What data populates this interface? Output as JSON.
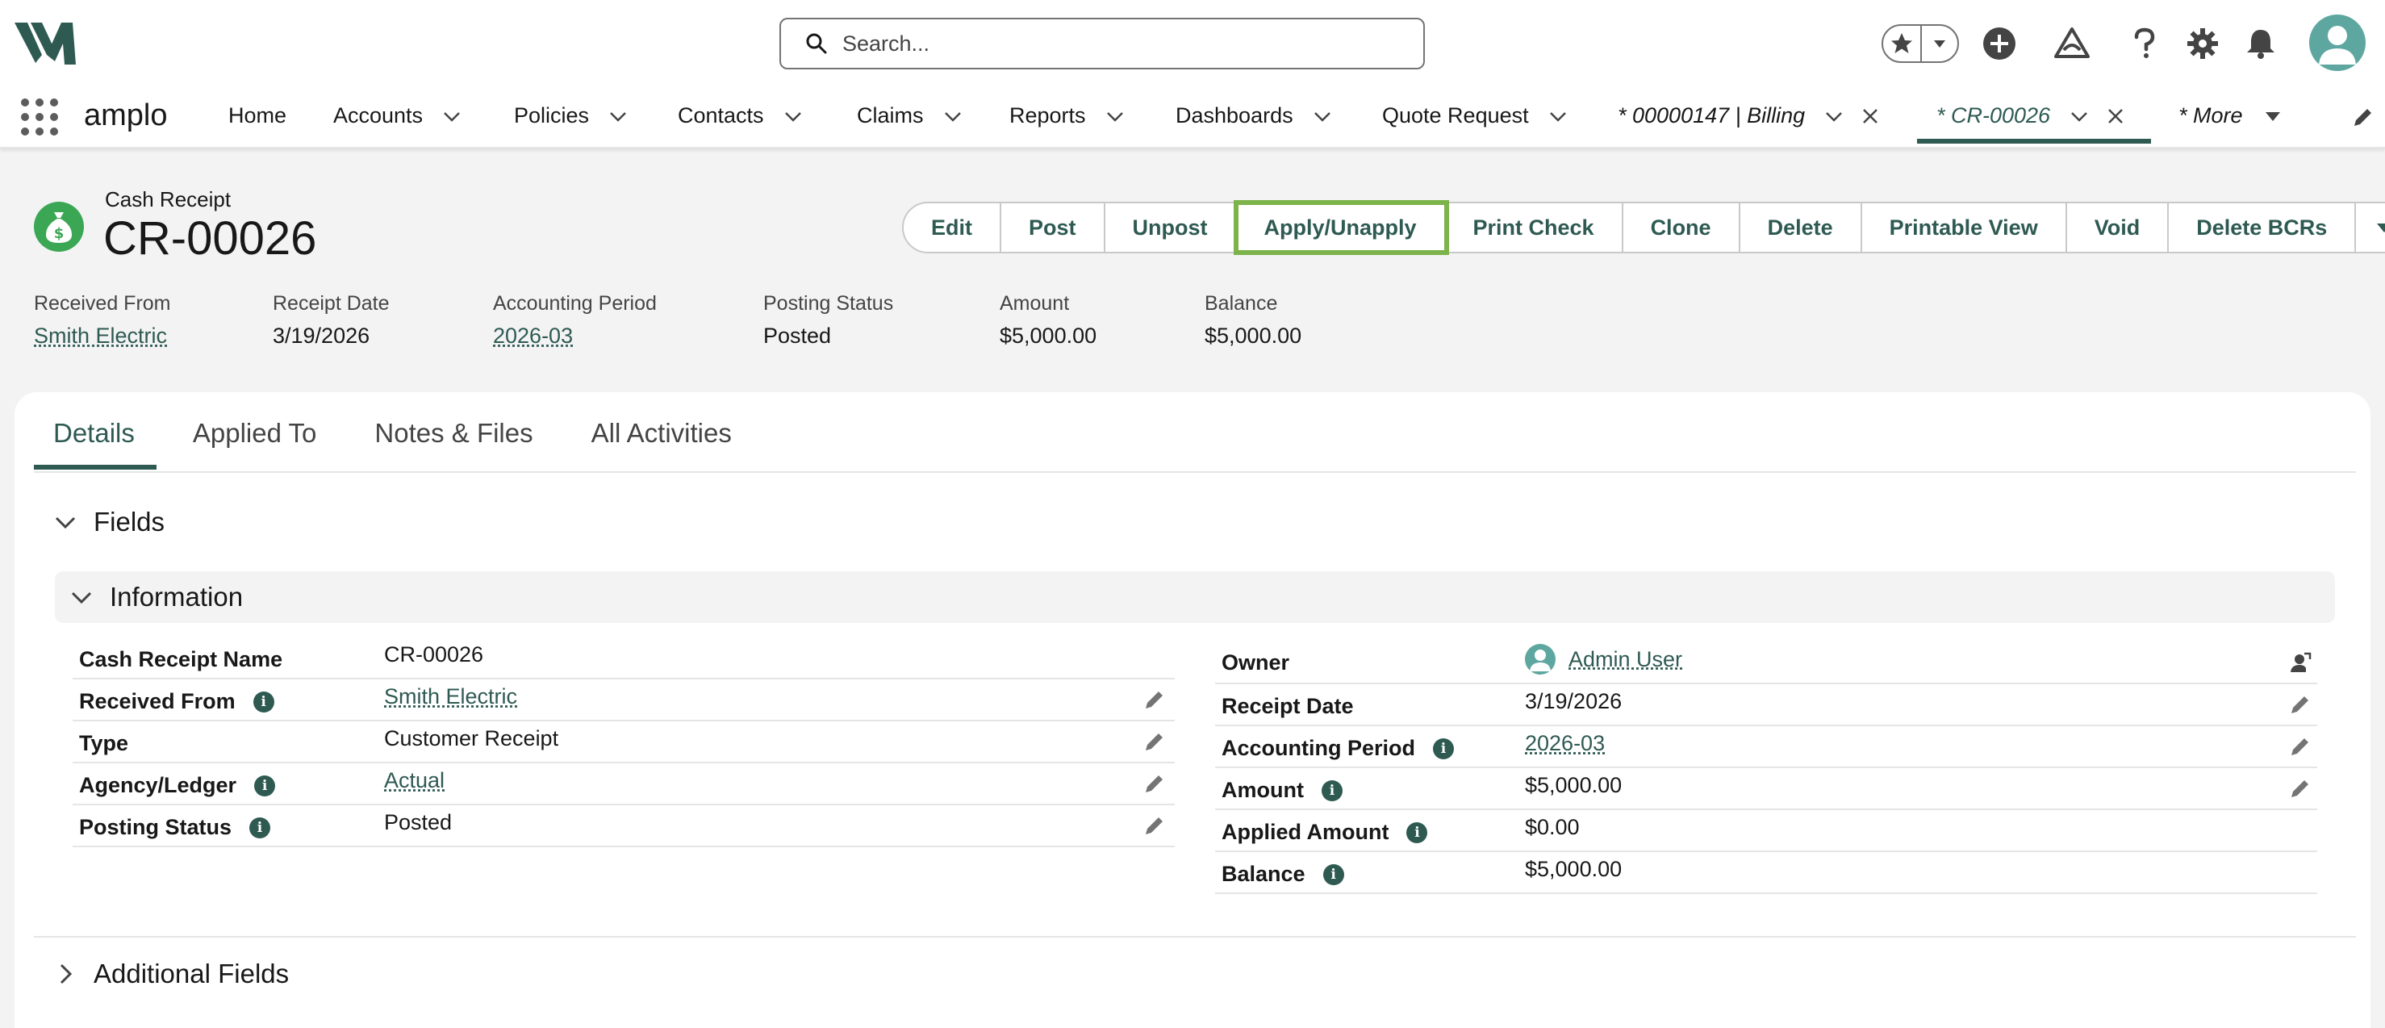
{
  "search": {
    "placeholder": "Search..."
  },
  "app": {
    "name": "amplo"
  },
  "nav": {
    "items": [
      {
        "label": "Home"
      },
      {
        "label": "Accounts"
      },
      {
        "label": "Policies"
      },
      {
        "label": "Contacts"
      },
      {
        "label": "Claims"
      },
      {
        "label": "Reports"
      },
      {
        "label": "Dashboards"
      },
      {
        "label": "Quote Request"
      }
    ],
    "tabs": [
      {
        "label": "* 00000147 | Billing"
      },
      {
        "label": "* CR-00026",
        "active": true
      }
    ],
    "more_label": "* More"
  },
  "record": {
    "type_label": "Cash Receipt",
    "name": "CR-00026",
    "icon": "money-bag-icon",
    "icon_color": "#3ba755"
  },
  "actions": [
    {
      "label": "Edit"
    },
    {
      "label": "Post"
    },
    {
      "label": "Unpost"
    },
    {
      "label": "Apply/Unapply",
      "highlighted": true
    },
    {
      "label": "Print Check"
    },
    {
      "label": "Clone"
    },
    {
      "label": "Delete"
    },
    {
      "label": "Printable View"
    },
    {
      "label": "Void"
    },
    {
      "label": "Delete BCRs"
    }
  ],
  "highlights": [
    {
      "label": "Received From",
      "value": "Smith Electric"
    },
    {
      "label": "Receipt Date",
      "value": "3/19/2026"
    },
    {
      "label": "Accounting Period",
      "value": "2026-03"
    },
    {
      "label": "Posting Status",
      "value": "Posted"
    },
    {
      "label": "Amount",
      "value": "$5,000.00"
    },
    {
      "label": "Balance",
      "value": "$5,000.00"
    }
  ],
  "tabs": [
    {
      "label": "Details",
      "active": true
    },
    {
      "label": "Applied To"
    },
    {
      "label": "Notes & Files"
    },
    {
      "label": "All Activities"
    }
  ],
  "sections": {
    "fields": "Fields",
    "information": "Information",
    "additional": "Additional Fields"
  },
  "left_fields": [
    {
      "label": "Cash Receipt Name",
      "value": "CR-00026"
    },
    {
      "label": "Received From",
      "value": "Smith Electric"
    },
    {
      "label": "Type",
      "value": "Customer Receipt"
    },
    {
      "label": "Agency/Ledger",
      "value": "Actual"
    },
    {
      "label": "Posting Status",
      "value": "Posted"
    }
  ],
  "right_fields": [
    {
      "label": "Owner",
      "value": "Admin User"
    },
    {
      "label": "Receipt Date",
      "value": "3/19/2026"
    },
    {
      "label": "Accounting Period",
      "value": "2026-03"
    },
    {
      "label": "Amount",
      "value": "$5,000.00"
    },
    {
      "label": "Applied Amount",
      "value": "$0.00"
    },
    {
      "label": "Balance",
      "value": "$5,000.00"
    }
  ],
  "colors": {
    "brand": "#2e5a52",
    "highlight_outline": "#7cb34a",
    "avatar": "#5ea7a0"
  }
}
